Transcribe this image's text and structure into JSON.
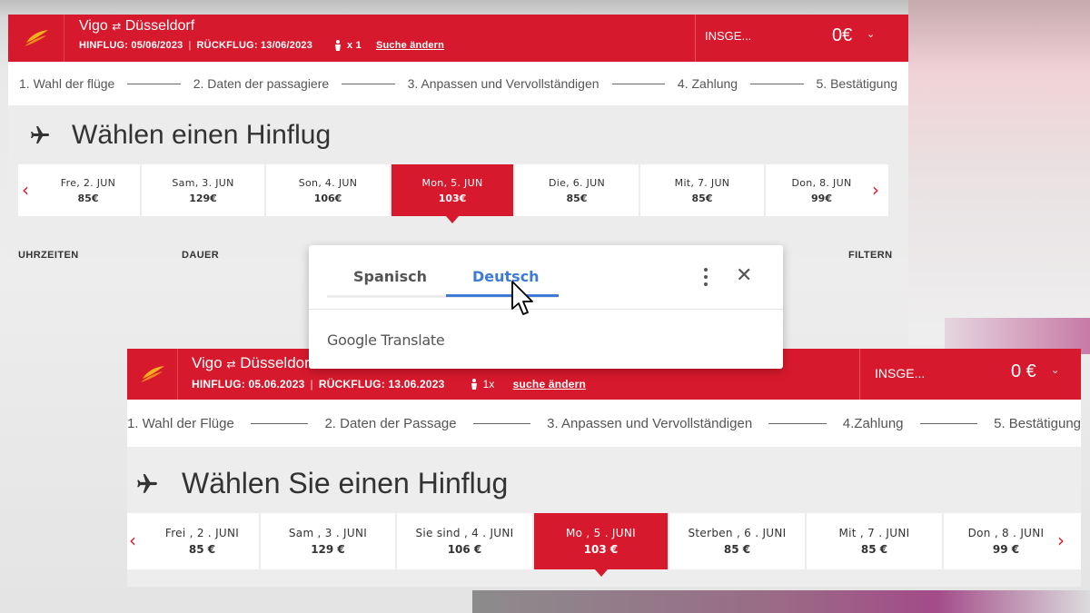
{
  "top": {
    "route_from": "Vigo",
    "route_swap": "⇄",
    "route_to": "Düsseldorf",
    "outbound": "HINFLUG: 05/06/2023",
    "return": "RÜCKFLUG: 13/06/2023",
    "passengers": "x 1",
    "change_search": "Suche ändern",
    "total_label": "INSGE...",
    "total_price": "0€",
    "steps": [
      "1. Wahl der flüge",
      "2. Daten der passagiere",
      "3. Anpassen und Vervollständigen",
      "4. Zahlung",
      "5. Bestätigung"
    ],
    "heading": "Wählen einen Hinflug",
    "days": [
      {
        "name": "Fre, 2. JUN",
        "price": "85€"
      },
      {
        "name": "Sam, 3. JUN",
        "price": "129€"
      },
      {
        "name": "Son, 4. JUN",
        "price": "106€"
      },
      {
        "name": "Mon, 5. JUN",
        "price": "103€"
      },
      {
        "name": "Die, 6. JUN",
        "price": "85€"
      },
      {
        "name": "Mit, 7. JUN",
        "price": "85€"
      },
      {
        "name": "Don, 8. JUN",
        "price": "99€"
      }
    ],
    "selected_day": 3,
    "filters": {
      "times": "UHRZEITEN",
      "duration": "DAUER",
      "filter": "FILTERN"
    }
  },
  "popup": {
    "tab_source": "Spanisch",
    "tab_target": "Deutsch",
    "brand": "Google Translate"
  },
  "bottom": {
    "route_from": "Vigo",
    "route_swap": "⇄",
    "route_to": "Düsseldorf",
    "outbound": "HINFLUG: 05.06.2023",
    "return": "RÜCKFLUG: 13.06.2023",
    "passengers": "1x",
    "change_search": "suche ändern",
    "total_label": "INSGE...",
    "total_price": "0 €",
    "steps": [
      "1. Wahl der Flüge",
      "2. Daten der Passage",
      "3. Anpassen und Vervollständigen",
      "4.Zahlung",
      "5. Bestätigung"
    ],
    "heading": "Wählen Sie einen Hinflug",
    "days": [
      {
        "name": "Frei , 2 . JUNI",
        "price": "85 €"
      },
      {
        "name": "Sam , 3 . JUNI",
        "price": "129 €"
      },
      {
        "name": "Sie sind , 4 . JUNI",
        "price": "106 €"
      },
      {
        "name": "Mo , 5 . JUNI",
        "price": "103 €"
      },
      {
        "name": "Sterben , 6 . JUNI",
        "price": "85 €"
      },
      {
        "name": "Mit , 7 . JUNI",
        "price": "85 €"
      },
      {
        "name": "Don , 8 . JUNI",
        "price": "99 €"
      }
    ],
    "selected_day": 3
  },
  "colors": {
    "brand_red": "#d7192d",
    "accent_blue": "#3d7bd6"
  },
  "icons": [
    "airline-logo-icon",
    "plane-icon",
    "person-icon",
    "chevron-down-icon",
    "chevron-left-icon",
    "chevron-right-icon",
    "more-vert-icon",
    "close-icon",
    "mouse-cursor-icon"
  ]
}
